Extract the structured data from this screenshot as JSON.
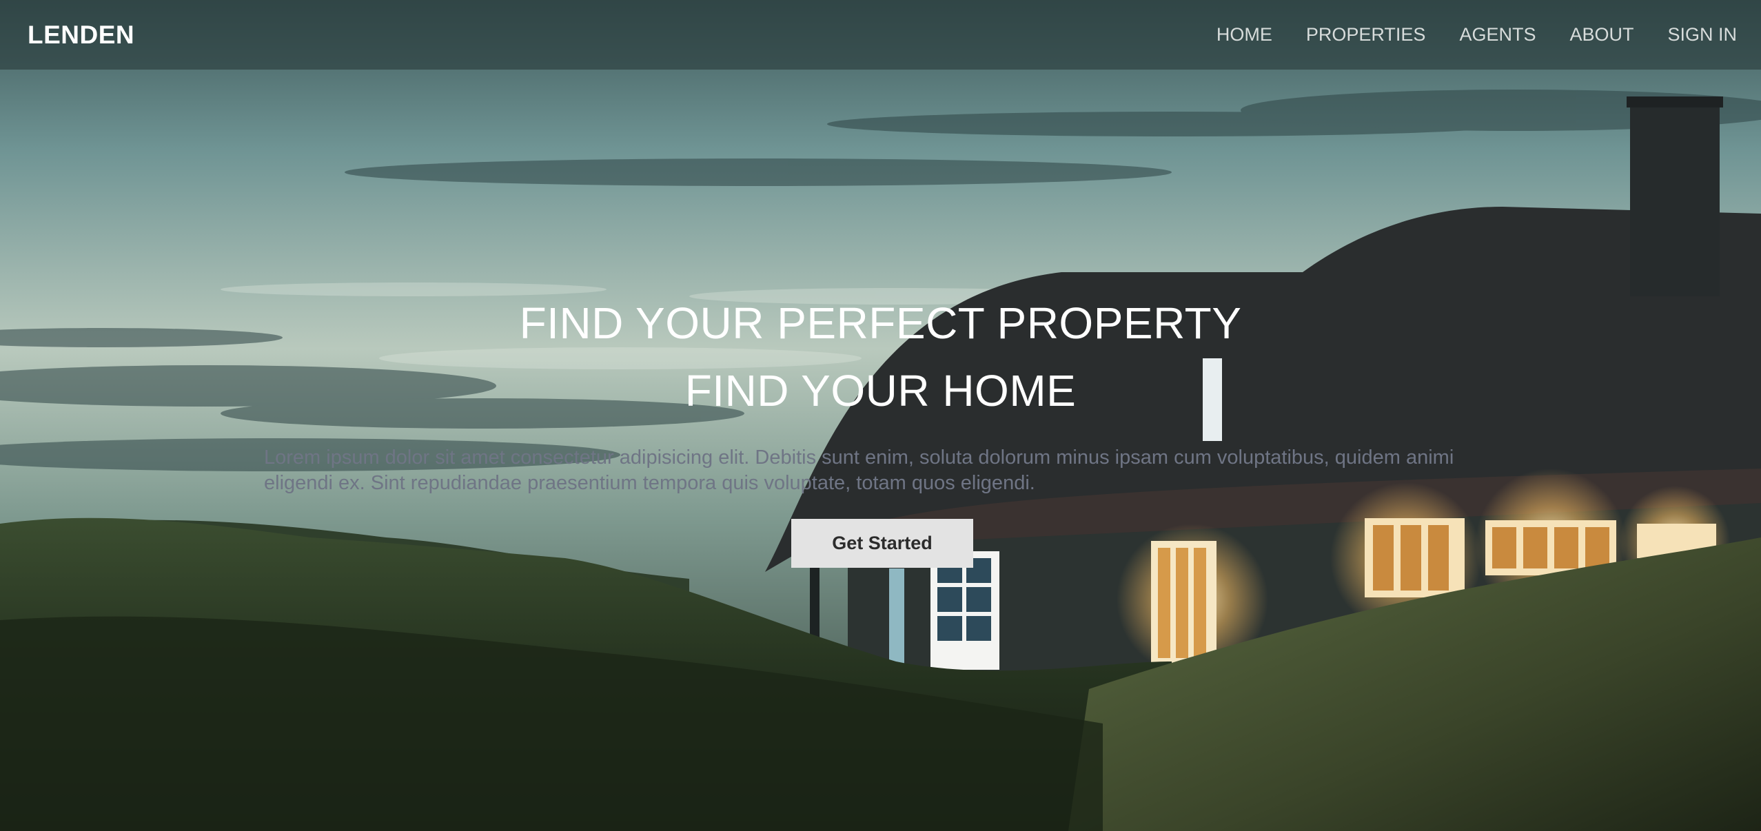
{
  "brand": {
    "name": "LENDEN"
  },
  "nav": {
    "items": [
      {
        "label": "HOME"
      },
      {
        "label": "PROPERTIES"
      },
      {
        "label": "AGENTS"
      },
      {
        "label": "ABOUT"
      },
      {
        "label": "SIGN IN"
      }
    ]
  },
  "hero": {
    "headline_1": "FIND YOUR PERFECT PROPERTY",
    "headline_2": "FIND YOUR HOME",
    "subtitle": "Lorem ipsum dolor sit amet consectetur adipisicing elit. Debitis sunt enim, soluta dolorum minus ipsam cum voluptatibus, quidem animi eligendi ex. Sint repudiandae praesentium tempora quis voluptate, totam quos eligendi.",
    "cta_label": "Get Started",
    "background_image": "thatched-cottage-at-dusk"
  },
  "colors": {
    "navbar_bg": "#3a5050",
    "button_bg": "#e3e3e3",
    "subtitle_text": "#6f7585"
  }
}
